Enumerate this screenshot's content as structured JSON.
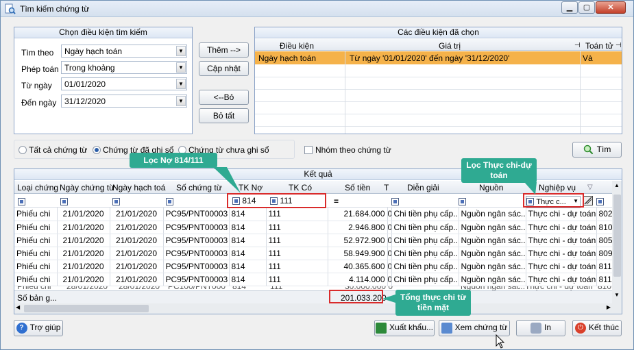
{
  "window": {
    "title": "Tìm kiếm chứng từ"
  },
  "left_panel": {
    "title": "Chọn điều kiện tìm kiếm",
    "fields": [
      {
        "label": "Tìm theo",
        "value": "Ngày hạch toán"
      },
      {
        "label": "Phép toán",
        "value": "Trong khoảng"
      },
      {
        "label": "Từ ngày",
        "value": "01/01/2020"
      },
      {
        "label": "Đến ngày",
        "value": "31/12/2020"
      }
    ]
  },
  "mid_buttons": {
    "add": "Thêm -->",
    "update": "Cập nhật",
    "remove": "<--Bỏ",
    "remove_all": "Bỏ tất"
  },
  "right_panel": {
    "title": "Các điều kiện đã chọn",
    "headers": [
      "Điều kiện",
      "Giá trị",
      "Toán tử"
    ],
    "row": {
      "condition": "Ngày hạch toán",
      "value": "Từ ngày '01/01/2020' đến ngày '31/12/2020'",
      "op": "Và"
    }
  },
  "filters": {
    "all": "Tất cả chứng từ",
    "posted": "Chứng từ đã ghi sổ",
    "unposted": "Chứng từ chưa ghi sổ",
    "group": "Nhóm theo chứng từ",
    "search": "Tìm"
  },
  "results": {
    "title": "Kết quả",
    "headers": [
      "Loại chứng",
      "Ngày chứng từ",
      "Ngày hạch toá",
      "Số chứng từ",
      "TK Nợ",
      "TK Có",
      "Số tiền",
      "T",
      "Diễn giải",
      "Nguồn",
      "Nghiệp vụ"
    ],
    "filter_row": {
      "tkno": "814",
      "tkco": "111",
      "eq": "=",
      "nv": "Thực c..."
    },
    "rows": [
      [
        "Phiếu chi",
        "21/01/2020",
        "21/01/2020",
        "PC95/PNT00003",
        "814",
        "111",
        "21.684.000",
        "0",
        "Chi tiền phụ cấp..",
        "Nguồn ngân sác..",
        "Thực chi - dự toán",
        "802"
      ],
      [
        "Phiếu chi",
        "21/01/2020",
        "21/01/2020",
        "PC95/PNT00003",
        "814",
        "111",
        "2.946.800",
        "0",
        "Chi tiền phụ cấp..",
        "Nguồn ngân sác..",
        "Thực chi - dự toán",
        "810"
      ],
      [
        "Phiếu chi",
        "21/01/2020",
        "21/01/2020",
        "PC95/PNT00003",
        "814",
        "111",
        "52.972.900",
        "0",
        "Chi tiền phụ cấp..",
        "Nguồn ngân sác..",
        "Thực chi - dự toán",
        "805"
      ],
      [
        "Phiếu chi",
        "21/01/2020",
        "21/01/2020",
        "PC95/PNT00003",
        "814",
        "111",
        "58.949.900",
        "0",
        "Chi tiền phụ cấp..",
        "Nguồn ngân sác..",
        "Thực chi - dự toán",
        "809"
      ],
      [
        "Phiếu chi",
        "21/01/2020",
        "21/01/2020",
        "PC95/PNT00003",
        "814",
        "111",
        "40.365.600",
        "0",
        "Chi tiền phụ cấp..",
        "Nguồn ngân sác..",
        "Thực chi - dự toán",
        "811"
      ],
      [
        "Phiếu chi",
        "21/01/2020",
        "21/01/2020",
        "PC95/PNT00003",
        "814",
        "111",
        "4.114.000",
        "0",
        "Chi tiền phụ cấp..",
        "Nguồn ngân sác..",
        "Thực chi - dự toán",
        "811"
      ]
    ],
    "footer_label": "Số bản g...",
    "total": "201.033.200"
  },
  "callouts": {
    "tk": "Lọc Nợ 814/111",
    "nv": "Lọc Thực chi-dự toán",
    "total": "Tổng thực chi từ tiền mặt"
  },
  "bottom": {
    "help": "Trợ giúp",
    "export": "Xuất khẩu...",
    "view": "Xem chứng từ",
    "print": "In",
    "exit": "Kết thúc"
  }
}
